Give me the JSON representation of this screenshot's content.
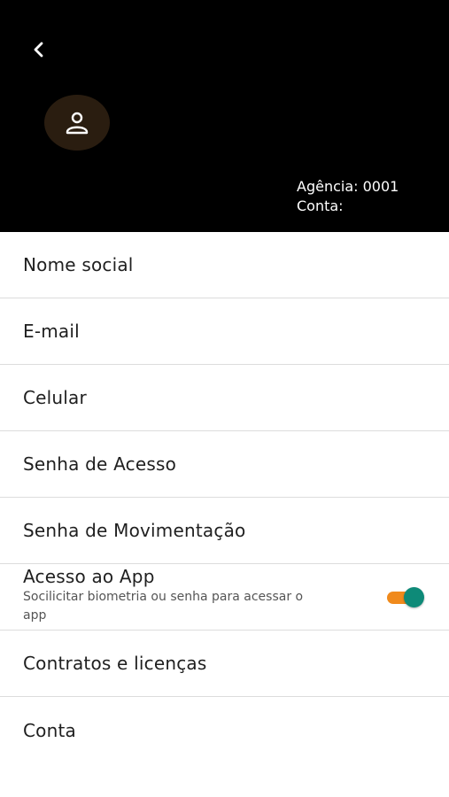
{
  "header": {
    "agencia": "Agência: 0001",
    "conta": "Conta:"
  },
  "icons": {
    "back": "chevron-left-icon",
    "avatar": "user-icon"
  },
  "menu": {
    "items": [
      {
        "label": "Nome social"
      },
      {
        "label": "E-mail"
      },
      {
        "label": "Celular"
      },
      {
        "label": "Senha de Acesso"
      },
      {
        "label": "Senha de Movimentação"
      },
      {
        "label": "Acesso ao App",
        "sublabel": "Socilicitar biometria ou senha para acessar o app",
        "toggle_on": true
      },
      {
        "label": "Contratos e licenças"
      },
      {
        "label": "Conta"
      }
    ]
  },
  "colors": {
    "header_bg": "#000000",
    "toggle_track": "#f08a1c",
    "toggle_thumb": "#0e8a78"
  }
}
